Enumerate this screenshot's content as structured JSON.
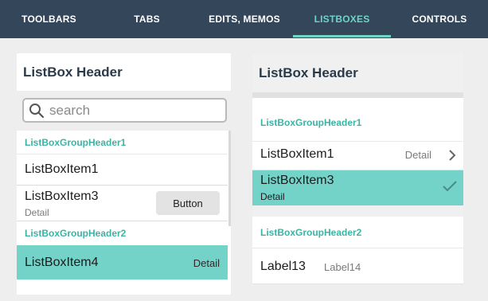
{
  "tabs": {
    "items": [
      {
        "label": "TOOLBARS",
        "active": false
      },
      {
        "label": "TABS",
        "active": false
      },
      {
        "label": "EDITS, MEMOS",
        "active": false
      },
      {
        "label": "LISTBOXES",
        "active": true
      },
      {
        "label": "CONTROLS",
        "active": false
      }
    ]
  },
  "left": {
    "header": "ListBox Header",
    "search": {
      "placeholder": "search",
      "value": ""
    },
    "group1": "ListBoxGroupHeader1",
    "item1": {
      "label": "ListBoxItem1"
    },
    "item3": {
      "label": "ListBoxItem3",
      "detail": "Detail",
      "button": "Button"
    },
    "group2": "ListBoxGroupHeader2",
    "item4": {
      "label": "ListBoxItem4",
      "detail": "Detail",
      "selected": true
    }
  },
  "right": {
    "header": "ListBox Header",
    "group1": "ListBoxGroupHeader1",
    "item1": {
      "label": "ListBoxItem1",
      "detail": "Detail",
      "accessory": "chevron-right-icon"
    },
    "item3": {
      "label": "ListBoxItem3",
      "detail": "Detail",
      "selected": true,
      "accessory": "checkmark-icon"
    },
    "group2": "ListBoxGroupHeader2",
    "label13": "Label13",
    "label14": "Label14"
  },
  "colors": {
    "topbar": "#34465a",
    "accent": "#6fd3c8",
    "selection": "#73d3c9",
    "group_header_text": "#3cb3a4"
  }
}
